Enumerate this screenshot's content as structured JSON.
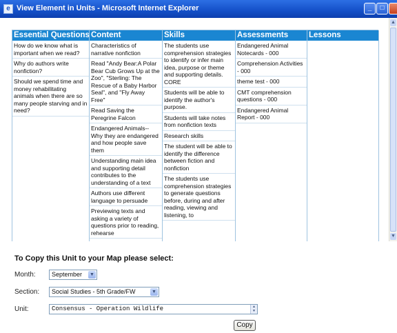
{
  "window": {
    "title": "View Element in Units - Microsoft Internet Explorer",
    "icon": "ie-page-icon"
  },
  "table": {
    "columns": [
      {
        "header": "Essential Questions",
        "cells": [
          "How do we know what is important when we read?",
          "Why do authors write nonfiction?",
          "Should we spend time and money rehabilitating animals when there are so many people starving and in need?"
        ]
      },
      {
        "header": "Content",
        "cells": [
          "Characteristics of narrative nonfiction",
          "Read \"Andy Bear:A Polar Bear Cub Grows Up at the Zoo\", \"Sterling: The Rescue of a Baby Harbor Seal\", and \"Fly Away Free\"",
          "Read Saving the Peregrine Falcon",
          "Endangered Animals--Why they are endangered and how people save them",
          "Understanding main idea and supporting detail contributes to the understanding of a text",
          "Authors use different language to persuade",
          "Previewing texts and asking a variety of questions prior to reading, rehearse"
        ]
      },
      {
        "header": "Skills",
        "cells": [
          "The students use comprehension strategies to identify or infer main idea, purpose or theme and supporting details. CORE",
          "Students will be able to identify the author's purpose.",
          "Students will take notes from nonfiction texts",
          "Research skills",
          "The student will be able to identify the difference between fiction and nonfiction",
          "The students use comprehension strategies to generate questions before, during and after reading, viewing and listening, to"
        ]
      },
      {
        "header": "Assessments",
        "cells": [
          "Endangered Animal Notecards - 000",
          "Comprehension Activities - 000",
          "theme test - 000",
          "CMT comprehension questions - 000",
          "Endangered Animal Report - 000"
        ]
      },
      {
        "header": "Lessons",
        "cells": []
      }
    ]
  },
  "form": {
    "heading": "To Copy this Unit to your Map please select:",
    "month_label": "Month:",
    "month_value": "September",
    "section_label": "Section:",
    "section_value": "Social Studies - 5th Grade/FW",
    "unit_label": "Unit:",
    "unit_value": "Consensus - Operation Wildlife",
    "copy_label": "Copy"
  },
  "colors": {
    "header_blue": "#1a86d2",
    "titlebar_blue": "#1450c8"
  }
}
